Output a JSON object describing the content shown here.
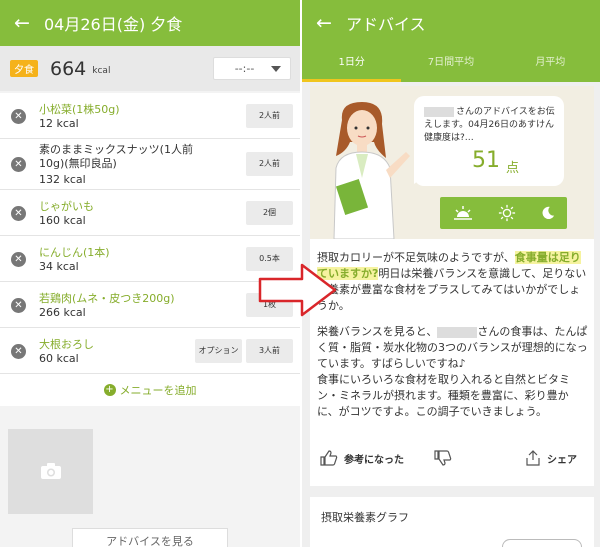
{
  "left": {
    "header": {
      "title": "04月26日(金) 夕食"
    },
    "summary": {
      "meal_badge": "夕食",
      "kcal": "664",
      "unit": "kcal",
      "time": "--:--"
    },
    "items": [
      {
        "name": "小松菜(1株50g)",
        "kcal": "12 kcal",
        "qty": "2人前"
      },
      {
        "name": "素のままミックスナッツ(1人前10g)(無印良品)",
        "kcal": "132 kcal",
        "qty": "2人前"
      },
      {
        "name": "じゃがいも",
        "kcal": "160 kcal",
        "qty": "2個"
      },
      {
        "name": "にんじん(1本)",
        "kcal": "34 kcal",
        "qty": "0.5本"
      },
      {
        "name": "若鶏肉(ムネ・皮つき200g)",
        "kcal": "266 kcal",
        "qty": "1枚"
      },
      {
        "name": "大根おろし",
        "kcal": "60 kcal",
        "qty": "3人前",
        "option": "オプション"
      }
    ],
    "add_menu": "メニューを追加",
    "advice_button": "アドバイスを見る"
  },
  "right": {
    "header": {
      "title": "アドバイス"
    },
    "tabs": [
      "1日分",
      "7日間平均",
      "月平均"
    ],
    "bubble": {
      "message_suffix": "さんのアドバイスをお伝えします。04月26日のあすけん健康度は?…",
      "score": "51",
      "score_unit": "点"
    },
    "advice": {
      "p1_a": "摂取カロリーが不足気味のようですが、",
      "p1_hl": "食事量は足りていますか?",
      "p1_b": "明日は栄養バランスを意識して、足りない栄養素が豊富な食材をプラスしてみてはいかがでしょうか。",
      "p2_a": "栄養バランスを見ると、",
      "p2_b": "さんの食事は、たんぱく質・脂質・炭水化物の3つのバランスが理想的になっています。すばらしいですね♪",
      "p2_c": "食事にいろいろな食材を取り入れると自然とビタミン・ミネラルが摂れます。種類を豊富に、彩り豊かに、がコツですよ。この調子でいきましょう。"
    },
    "actions": {
      "helpful": "参考になった",
      "share": "シェア"
    },
    "graph_title": "摂取栄養素グラフ"
  },
  "colors": {
    "brand_green": "#86bd3c",
    "badge_orange": "#f5b21b",
    "tab_indicator": "#f0c51e",
    "arrow_red": "#d9262a"
  }
}
